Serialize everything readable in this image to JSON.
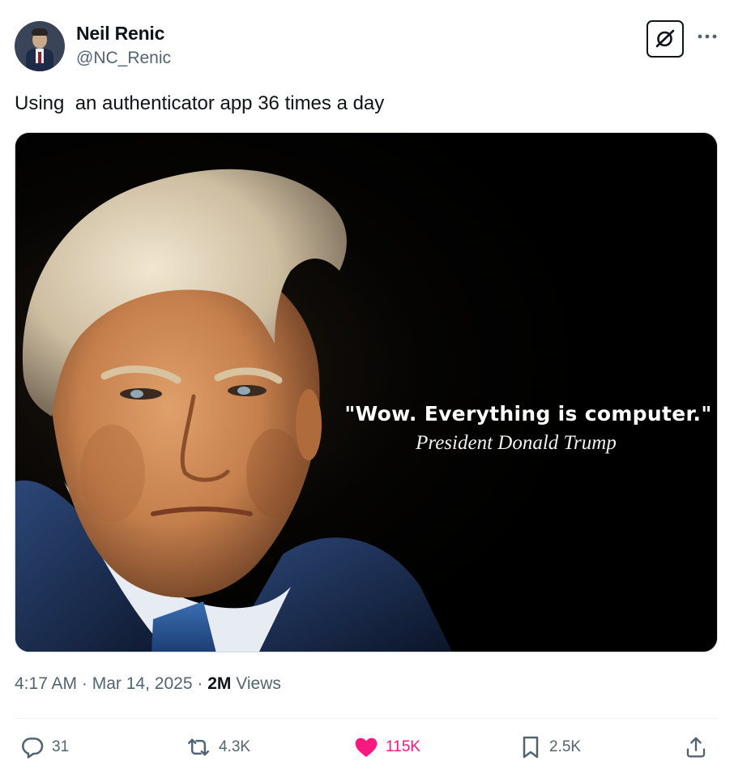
{
  "author": {
    "name": "Neil Renic",
    "handle": "@NC_Renic"
  },
  "tweet": {
    "text": "Using  an authenticator app 36 times a day"
  },
  "media": {
    "quote": "\"Wow. Everything is computer.\"",
    "attribution": "President Donald Trump"
  },
  "meta": {
    "time": "4:17 AM",
    "separator": "·",
    "date": "Mar 14, 2025",
    "views_count": "2M",
    "views_label": "Views"
  },
  "actions": {
    "replies": "31",
    "reposts": "4.3K",
    "likes": "115K",
    "bookmarks": "2.5K"
  },
  "colors": {
    "text_primary": "#0f1419",
    "text_secondary": "#536471",
    "like_active": "#f91880",
    "divider": "#eff3f4"
  },
  "icons": [
    "grok-icon",
    "more-icon",
    "reply-icon",
    "repost-icon",
    "like-icon",
    "bookmark-icon",
    "share-icon"
  ]
}
